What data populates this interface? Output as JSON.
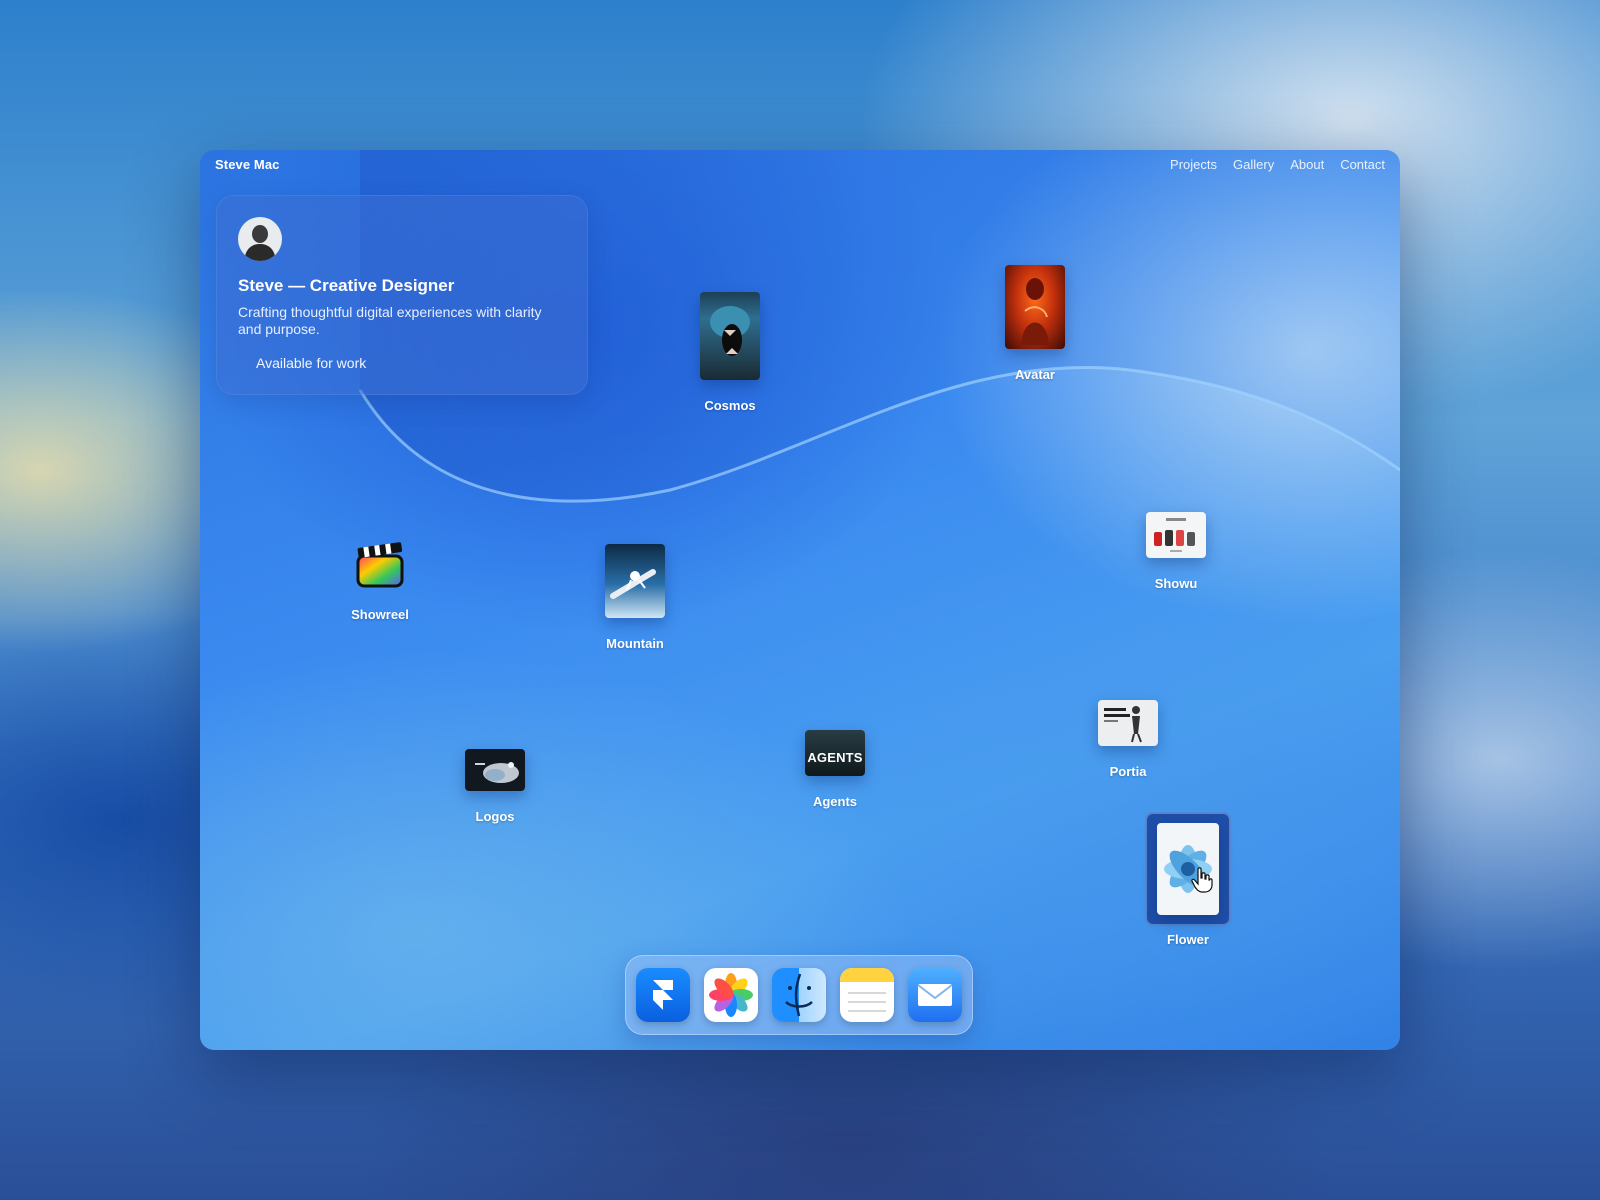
{
  "app": {
    "brand": "Steve Mac"
  },
  "nav": {
    "projects": "Projects",
    "gallery": "Gallery",
    "about": "About",
    "contact": "Contact"
  },
  "profile": {
    "title": "Steve — Creative Designer",
    "description": "Crafting thoughtful digital experiences with clarity and purpose.",
    "status": "Available for work"
  },
  "items": {
    "cosmos": {
      "label": "Cosmos",
      "icon": "cosmos-thumbnail"
    },
    "avatar": {
      "label": "Avatar",
      "icon": "avatar-thumbnail"
    },
    "showreel": {
      "label": "Showreel",
      "icon": "clapperboard-icon"
    },
    "mountain": {
      "label": "Mountain",
      "icon": "mountain-thumbnail"
    },
    "showu": {
      "label": "Showu",
      "icon": "showu-thumbnail"
    },
    "portia": {
      "label": "Portia",
      "icon": "portia-thumbnail"
    },
    "logos": {
      "label": "Logos",
      "icon": "logos-thumbnail"
    },
    "agents": {
      "label": "Agents",
      "icon": "agents-thumbnail",
      "thumb_text": "AGENTS"
    },
    "flower": {
      "label": "Flower",
      "icon": "flower-thumbnail",
      "selected": true
    }
  },
  "dock": [
    {
      "name": "framer-app-icon"
    },
    {
      "name": "photos-app-icon"
    },
    {
      "name": "finder-app-icon"
    },
    {
      "name": "notes-app-icon"
    },
    {
      "name": "mail-app-icon"
    }
  ],
  "colors": {
    "accent": "#2f7fe6",
    "selection": "#1e4fa8"
  }
}
